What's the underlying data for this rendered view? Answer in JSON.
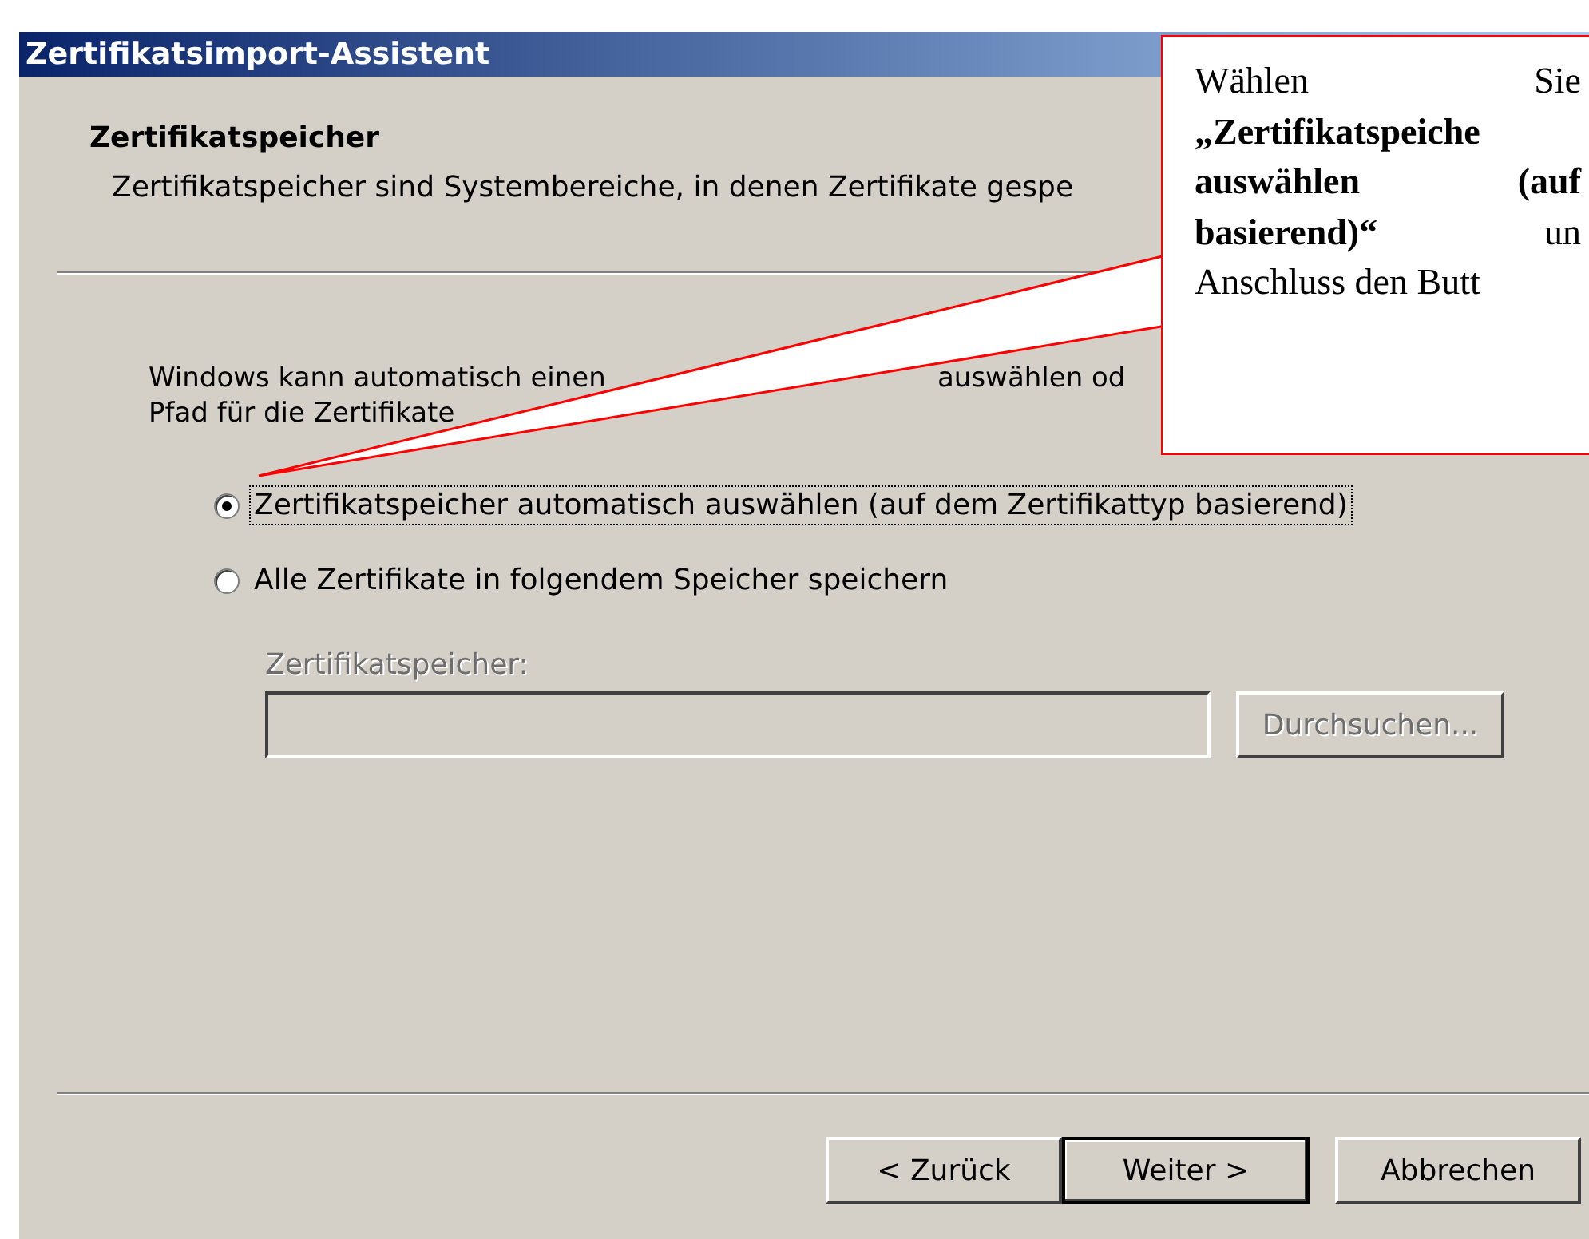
{
  "window": {
    "title": "Zertifikatsimport-Assistent"
  },
  "header": {
    "title": "Zertifikatspeicher",
    "description": "Zertifikatspeicher sind Systembereiche, in denen Zertifikate gespe"
  },
  "intro_lines": [
    [
      "Windows kann automatisch einen",
      "auswählen od"
    ],
    [
      "Pfad für die Zertifikate"
    ]
  ],
  "options": [
    {
      "label": "Zertifikatspeicher automatisch auswählen (auf dem Zertifikattyp basierend)",
      "selected": true,
      "focused": true
    },
    {
      "label": "Alle Zertifikate in folgendem Speicher speichern",
      "selected": false,
      "focused": false
    }
  ],
  "store": {
    "label": "Zertifikatspeicher:",
    "disabled": true,
    "browse_button": "Durchsuchen..."
  },
  "buttons": [
    {
      "label": "< Zurück",
      "default": false
    },
    {
      "label": "Weiter >",
      "default": true
    },
    {
      "label": "Abbrechen",
      "default": false
    }
  ],
  "callout": {
    "lines": [
      "Wählen Sie",
      "**„Zertifikatspeiche**",
      "**auswählen (auf**",
      "**basierend)“** un",
      "Anschluss den Butt"
    ]
  }
}
